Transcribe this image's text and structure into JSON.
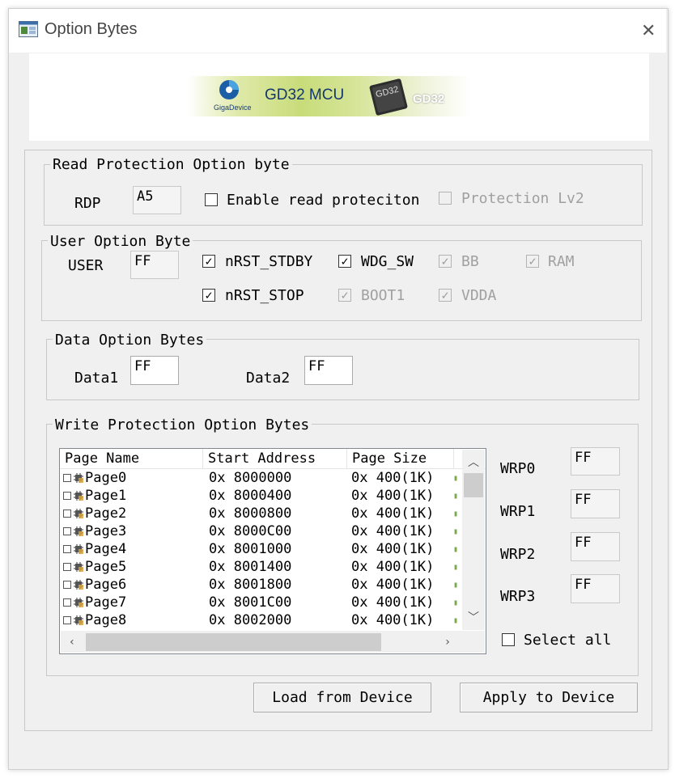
{
  "window": {
    "title": "Option Bytes"
  },
  "banner": {
    "brand": "GigaDevice",
    "product": "GD32 MCU",
    "chip": "GD32",
    "mascot": "GD32"
  },
  "read_protection": {
    "legend": "Read Protection Option byte",
    "rdp_label": "RDP",
    "rdp_value": "A5",
    "enable_label": "Enable read proteciton",
    "enable_checked": false,
    "lv2_label": "Protection Lv2",
    "lv2_checked": false
  },
  "user_option": {
    "legend": "User Option Byte",
    "user_label": "USER",
    "user_value": "FF",
    "checks": [
      {
        "label": "nRST_STDBY",
        "checked": true,
        "enabled": true
      },
      {
        "label": "WDG_SW",
        "checked": true,
        "enabled": true
      },
      {
        "label": "BB",
        "checked": true,
        "enabled": false
      },
      {
        "label": "RAM",
        "checked": true,
        "enabled": false
      },
      {
        "label": "nRST_STOP",
        "checked": true,
        "enabled": true
      },
      {
        "label": "BOOT1",
        "checked": true,
        "enabled": false
      },
      {
        "label": "VDDA",
        "checked": true,
        "enabled": false
      }
    ]
  },
  "data_option": {
    "legend": "Data Option Bytes",
    "data1_label": "Data1",
    "data1_value": "FF",
    "data2_label": "Data2",
    "data2_value": "FF"
  },
  "write_protection": {
    "legend": "Write Protection Option Bytes",
    "columns": [
      "Page Name",
      "Start Address",
      "Page Size"
    ],
    "rows": [
      {
        "name": "Page0",
        "address": "0x 8000000",
        "size": "0x 400(1K)"
      },
      {
        "name": "Page1",
        "address": "0x 8000400",
        "size": "0x 400(1K)"
      },
      {
        "name": "Page2",
        "address": "0x 8000800",
        "size": "0x 400(1K)"
      },
      {
        "name": "Page3",
        "address": "0x 8000C00",
        "size": "0x 400(1K)"
      },
      {
        "name": "Page4",
        "address": "0x 8001000",
        "size": "0x 400(1K)"
      },
      {
        "name": "Page5",
        "address": "0x 8001400",
        "size": "0x 400(1K)"
      },
      {
        "name": "Page6",
        "address": "0x 8001800",
        "size": "0x 400(1K)"
      },
      {
        "name": "Page7",
        "address": "0x 8001C00",
        "size": "0x 400(1K)"
      },
      {
        "name": "Page8",
        "address": "0x 8002000",
        "size": "0x 400(1K)"
      }
    ],
    "wrp": [
      {
        "label": "WRP0",
        "value": "FF"
      },
      {
        "label": "WRP1",
        "value": "FF"
      },
      {
        "label": "WRP2",
        "value": "FF"
      },
      {
        "label": "WRP3",
        "value": "FF"
      }
    ],
    "select_all_label": "Select all"
  },
  "buttons": {
    "load": "Load from Device",
    "apply": "Apply to Device"
  },
  "icons": {
    "app": "app-window-icon",
    "close": "close-icon",
    "row": "page-chip-icon"
  }
}
